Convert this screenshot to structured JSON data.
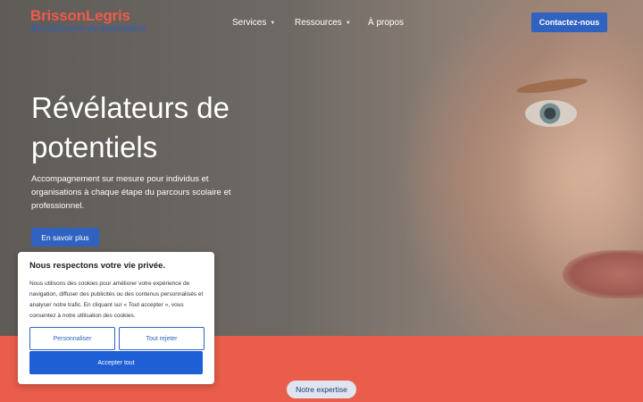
{
  "brand": {
    "name_part1": "Brisson",
    "name_part2": "Legris",
    "tagline": "Révélateurs de potentiels"
  },
  "nav": {
    "items": [
      {
        "label": "Services",
        "has_dropdown": true
      },
      {
        "label": "Ressources",
        "has_dropdown": true
      },
      {
        "label": "À propos",
        "has_dropdown": false
      }
    ],
    "cta": "Contactez-nous"
  },
  "hero": {
    "title_line1": "Révélateurs de",
    "title_line2": "potentiels",
    "subtitle": "Accompagnement sur mesure pour individus et organisations à chaque étape du parcours scolaire et professionnel.",
    "button": "En savoir plus"
  },
  "cookie": {
    "title": "Nous respectons votre vie privée.",
    "text": "Nous utilisons des cookies pour améliorer votre expérience de navigation, diffuser des publicités ou des contenus personnalisés et analyser notre trafic. En cliquant sur « Tout accepter », vous consentez à notre utilisation des cookies.",
    "customize": "Personnaliser",
    "reject": "Tout rejeter",
    "accept": "Accepter tout"
  },
  "section_pill": "Notre expertise",
  "colors": {
    "brand_red": "#ef5a4b",
    "primary_blue": "#2f62c1",
    "band": "#e95d4a"
  },
  "icons": {
    "dropdown": "chevron-down-icon"
  }
}
